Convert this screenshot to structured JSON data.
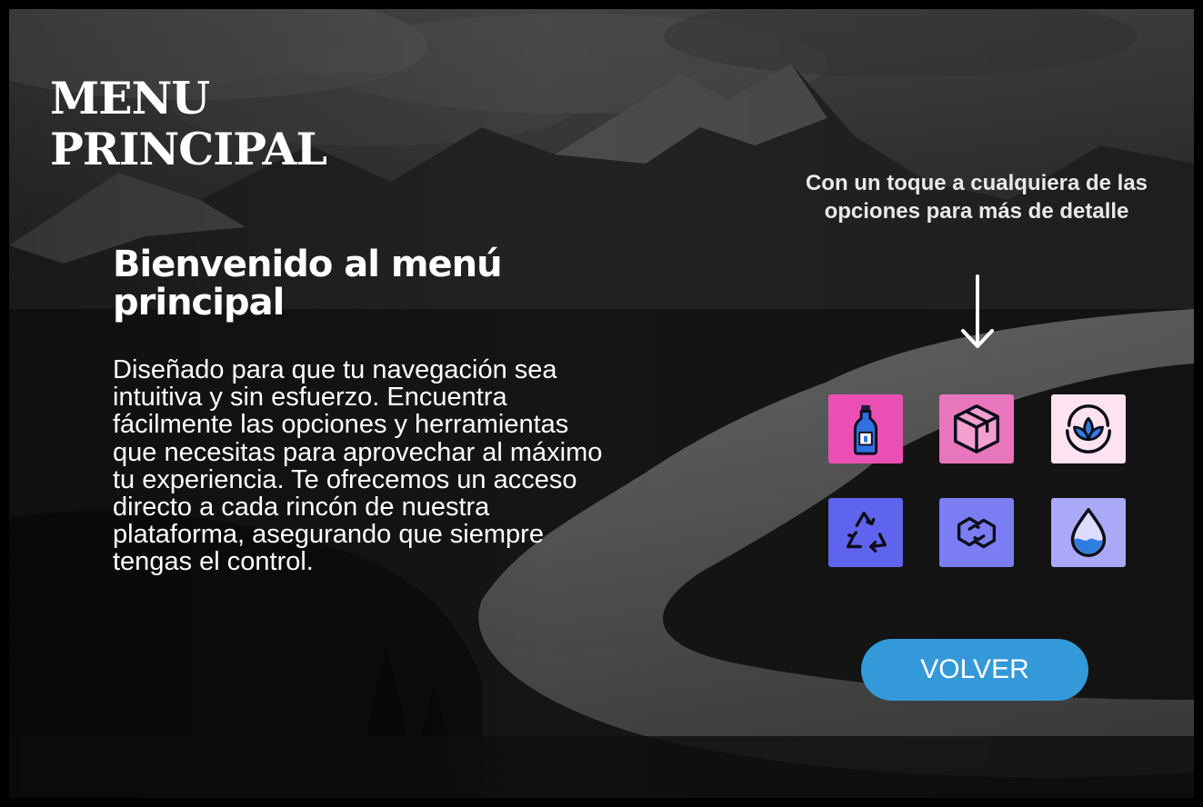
{
  "page": {
    "title_lines": [
      "MENU",
      "PRINCIPAL"
    ]
  },
  "welcome": {
    "heading": "Bienvenido al menú principal",
    "description": "Diseñado para que tu navegación sea intuitiva y sin esfuerzo. Encuentra fácilmente las opciones y herramientas que necesitas para aprovechar al máximo tu experiencia. Te ofrecemos un acceso directo a cada rincón de nuestra plataforma, asegurando que siempre tengas el control."
  },
  "hint": {
    "text": "Con un toque a cualquiera de las opciones para más de detalle",
    "arrow_icon": "arrow-down-icon"
  },
  "options": [
    {
      "icon": "bottle-icon",
      "color": "#ec4fb3"
    },
    {
      "icon": "package-box-icon",
      "color": "#e876bc"
    },
    {
      "icon": "lotus-leaf-icon",
      "color": "#fde3f0"
    },
    {
      "icon": "recycle-icon",
      "color": "#5f64ef"
    },
    {
      "icon": "infinity-chain-icon",
      "color": "#7b7ef3"
    },
    {
      "icon": "water-drop-icon",
      "color": "#a9a9f8"
    }
  ],
  "back_button": {
    "label": "VOLVER",
    "color": "#3399d9"
  }
}
